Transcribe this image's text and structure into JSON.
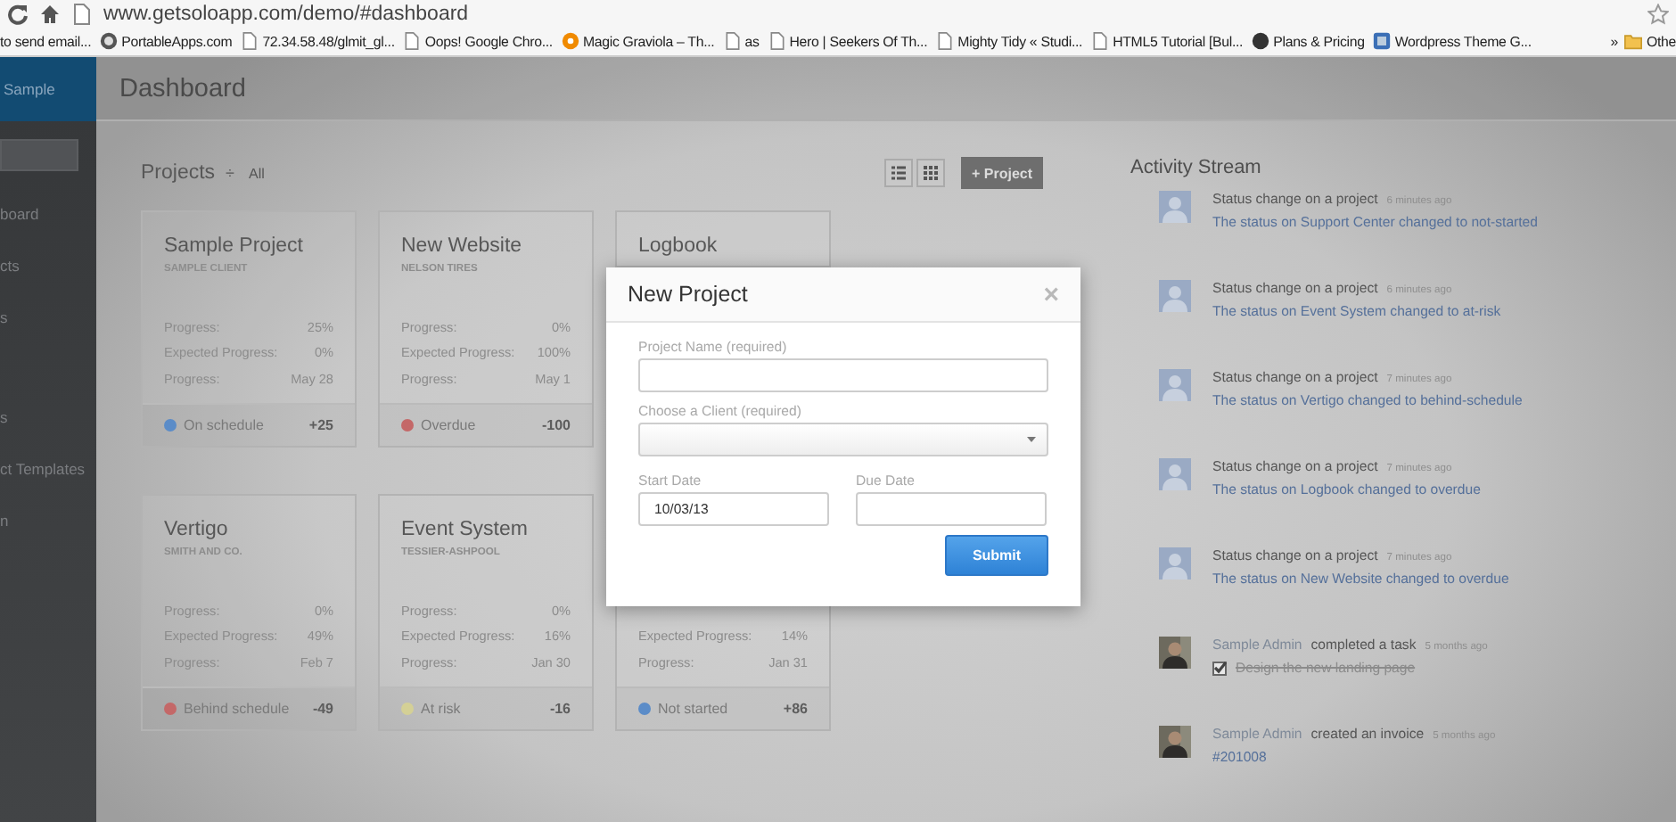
{
  "browser": {
    "url": "www.getsoloapp.com/demo/#dashboard",
    "bookmarks": [
      "to send email...",
      "PortableApps.com",
      "72.34.58.48/glmit_gl...",
      "Oops! Google Chro...",
      "Magic Graviola – Th...",
      "as",
      "Hero | Seekers Of Th...",
      "Mighty Tidy « Studi...",
      "HTML5 Tutorial [Bul...",
      "Plans & Pricing",
      "Wordpress Theme G..."
    ],
    "more": "»",
    "other": "Othe"
  },
  "sidebar": {
    "brand": "Sample",
    "items": [
      "board",
      "cts",
      "s",
      "s",
      "ct Templates",
      "n"
    ]
  },
  "header": {
    "title": "Dashboard"
  },
  "projects": {
    "title": "Projects",
    "sort": "÷",
    "filter": "All",
    "add_button": "+ Project",
    "cards": [
      {
        "name": "Sample Project",
        "client": "SAMPLE CLIENT",
        "rows": [
          {
            "label": "Progress:",
            "value": "25%"
          },
          {
            "label": "Expected Progress:",
            "value": "0%"
          },
          {
            "label": "Progress:",
            "value": "May 28"
          }
        ],
        "status": "On schedule",
        "color": "#5b8cc8",
        "delta": "+25"
      },
      {
        "name": "New Website",
        "client": "NELSON TIRES",
        "rows": [
          {
            "label": "Progress:",
            "value": "0%"
          },
          {
            "label": "Expected Progress:",
            "value": "100%"
          },
          {
            "label": "Progress:",
            "value": "May 1"
          }
        ],
        "status": "Overdue",
        "color": "#c46868",
        "delta": "-100"
      },
      {
        "name": "Logbook"
      },
      {
        "name": "Vertigo",
        "client": "SMITH AND CO.",
        "rows": [
          {
            "label": "Progress:",
            "value": "0%"
          },
          {
            "label": "Expected Progress:",
            "value": "49%"
          },
          {
            "label": "Progress:",
            "value": "Feb 7"
          }
        ],
        "status": "Behind schedule",
        "color": "#c46868",
        "delta": "-49"
      },
      {
        "name": "Event System",
        "client": "TESSIER-ASHPOOL",
        "rows": [
          {
            "label": "Progress:",
            "value": "0%"
          },
          {
            "label": "Expected Progress:",
            "value": "16%"
          },
          {
            "label": "Progress:",
            "value": "Jan 30"
          }
        ],
        "status": "At risk",
        "color": "#d4d096",
        "delta": "-16"
      },
      {
        "rows": [
          {
            "label": "Expected Progress:",
            "value": "14%"
          },
          {
            "label": "Progress:",
            "value": "Jan 31"
          }
        ],
        "status": "Not started",
        "color": "#5b8cc8",
        "delta": "+86"
      }
    ]
  },
  "activity": {
    "title": "Activity Stream",
    "items": [
      {
        "kind": "status",
        "action": "Status change on a project",
        "time": "6 minutes ago",
        "detail": "The status on Support Center changed to not-started"
      },
      {
        "kind": "status",
        "action": "Status change on a project",
        "time": "6 minutes ago",
        "detail": "The status on Event System changed to at-risk"
      },
      {
        "kind": "status",
        "action": "Status change on a project",
        "time": "7 minutes ago",
        "detail": "The status on Vertigo changed to behind-schedule"
      },
      {
        "kind": "status",
        "action": "Status change on a project",
        "time": "7 minutes ago",
        "detail": "The status on Logbook changed to overdue"
      },
      {
        "kind": "status",
        "action": "Status change on a project",
        "time": "7 minutes ago",
        "detail": "The status on New Website changed to overdue"
      },
      {
        "kind": "task",
        "actor": "Sample Admin",
        "action": "completed a task",
        "time": "5 months ago",
        "detail": "Design the new landing page",
        "checked": true
      },
      {
        "kind": "invoice",
        "actor": "Sample Admin",
        "action": "created an invoice",
        "time": "5 months ago",
        "detail": "#201008"
      }
    ]
  },
  "modal": {
    "title": "New Project",
    "close": "×",
    "fields": [
      {
        "kind": "text",
        "label": "Project Name (required)"
      },
      {
        "kind": "select",
        "label": "Choose a Client (required)"
      },
      {
        "kind": "date",
        "label": "Start Date",
        "value": "10/03/13"
      },
      {
        "kind": "date",
        "label": "Due Date"
      }
    ],
    "submit": "Submit"
  }
}
